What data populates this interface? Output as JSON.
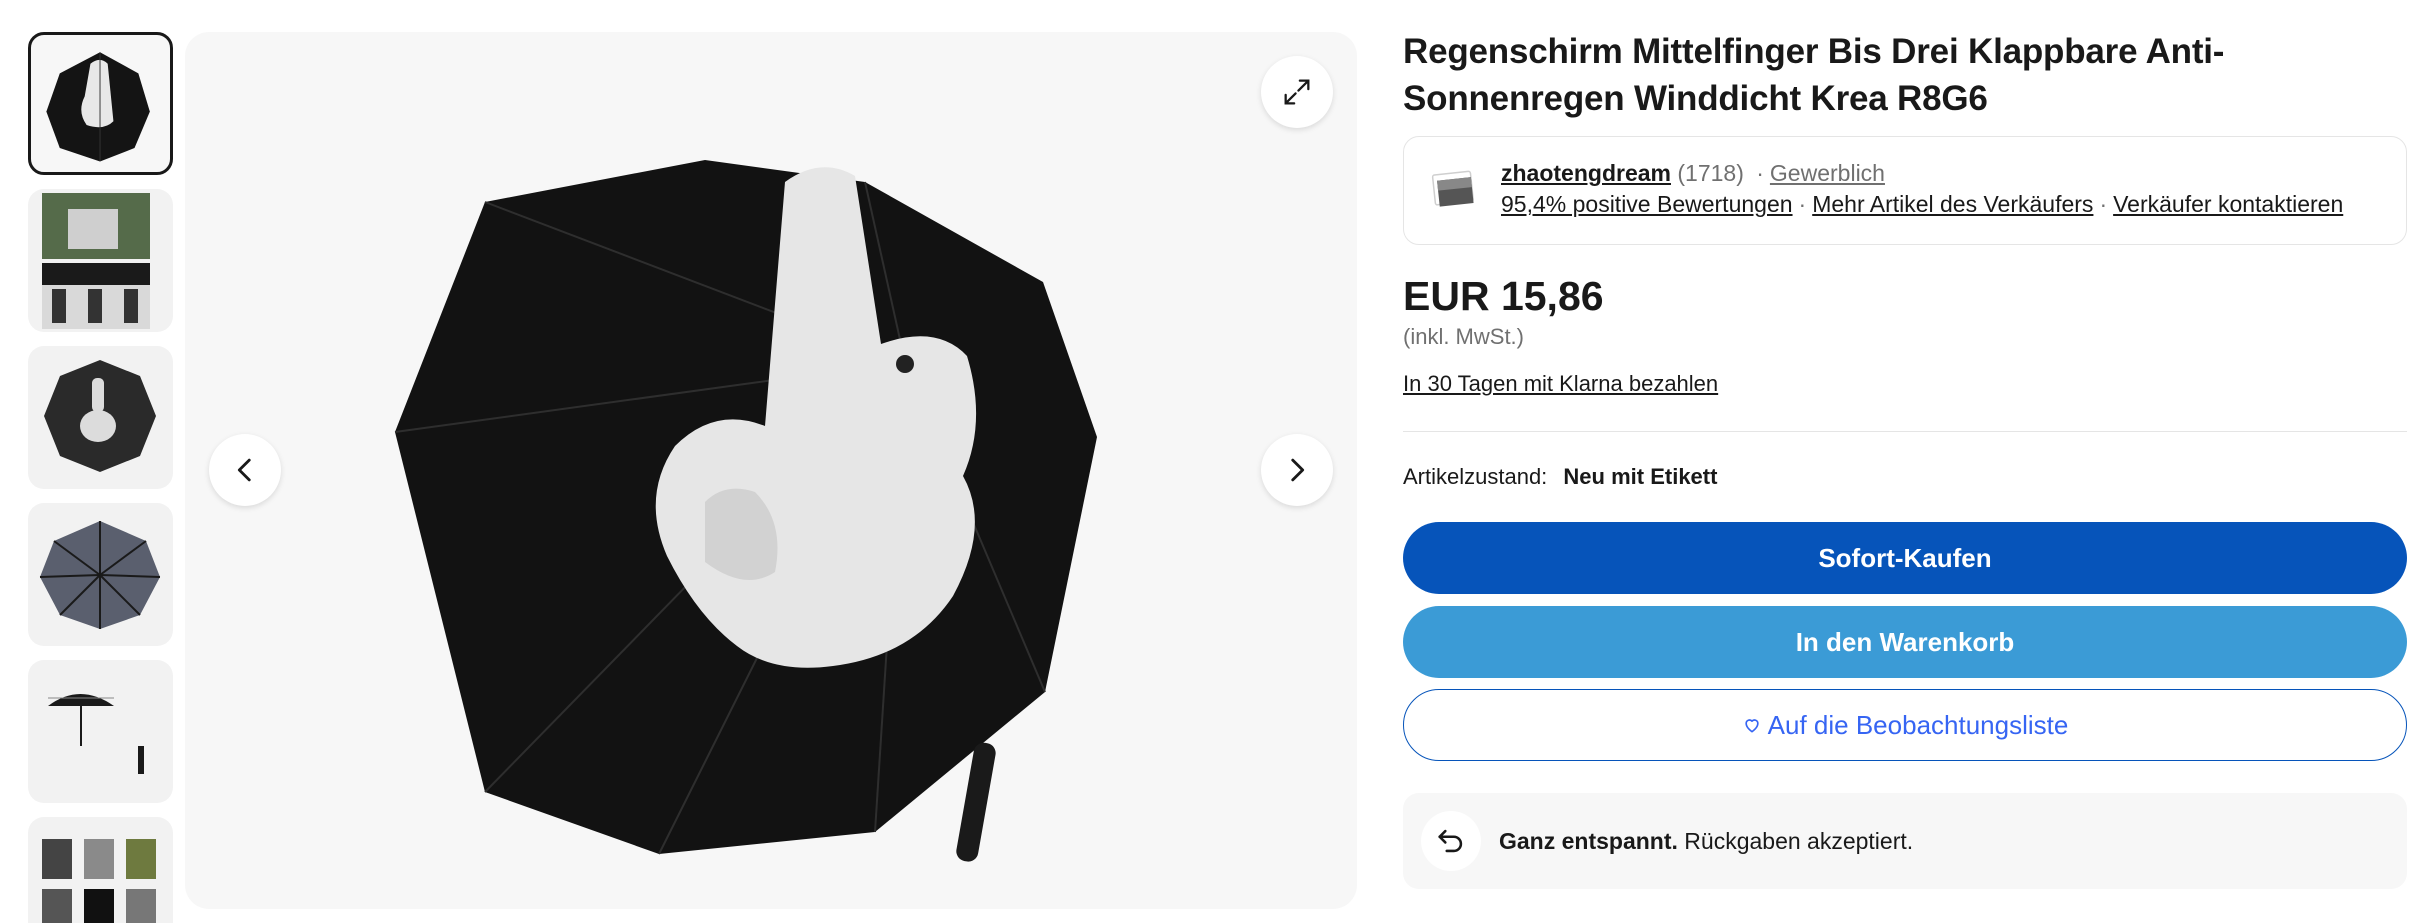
{
  "gallery": {
    "thumbnails": [
      {
        "alt": "umbrella-photo-1",
        "active": true
      },
      {
        "alt": "umbrella-photo-2",
        "active": false
      },
      {
        "alt": "umbrella-photo-3",
        "active": false
      },
      {
        "alt": "umbrella-photo-4",
        "active": false
      },
      {
        "alt": "umbrella-photo-5",
        "active": false
      },
      {
        "alt": "umbrella-photo-6",
        "active": false
      }
    ],
    "icons": {
      "expand": "expand-icon",
      "prev": "chevron-left-icon",
      "next": "chevron-right-icon"
    }
  },
  "product": {
    "title": "Regenschirm Mittelfinger Bis Drei Klappbare Anti-Sonnenregen Winddicht Krea R8G6",
    "price": "EUR 15,86",
    "vat_note": "(inkl. MwSt.)",
    "financing_link": "In 30 Tagen mit Klarna bezahlen",
    "condition_label": "Artikelzustand:",
    "condition_value": "Neu mit Etikett"
  },
  "seller": {
    "name": "zhaotengdream",
    "feedback_count": "(1718)",
    "separator": "·",
    "type": "Gewerblich",
    "positive_rating": "95,4% positive Bewertungen",
    "more_items": "Mehr Artikel des Verkäufers",
    "contact": "Verkäufer kontaktieren"
  },
  "actions": {
    "buy_now": "Sofort-Kaufen",
    "add_to_cart": "In den Warenkorb",
    "watchlist": "Auf die Beobachtungsliste"
  },
  "returns": {
    "bold": "Ganz entspannt.",
    "text": " Rückgaben akzeptiert."
  },
  "colors": {
    "buy_button": "#0654ba",
    "cart_button": "#3b9bd6",
    "watch_text": "#3665f3",
    "text_primary": "#191919",
    "text_muted": "#707070"
  }
}
